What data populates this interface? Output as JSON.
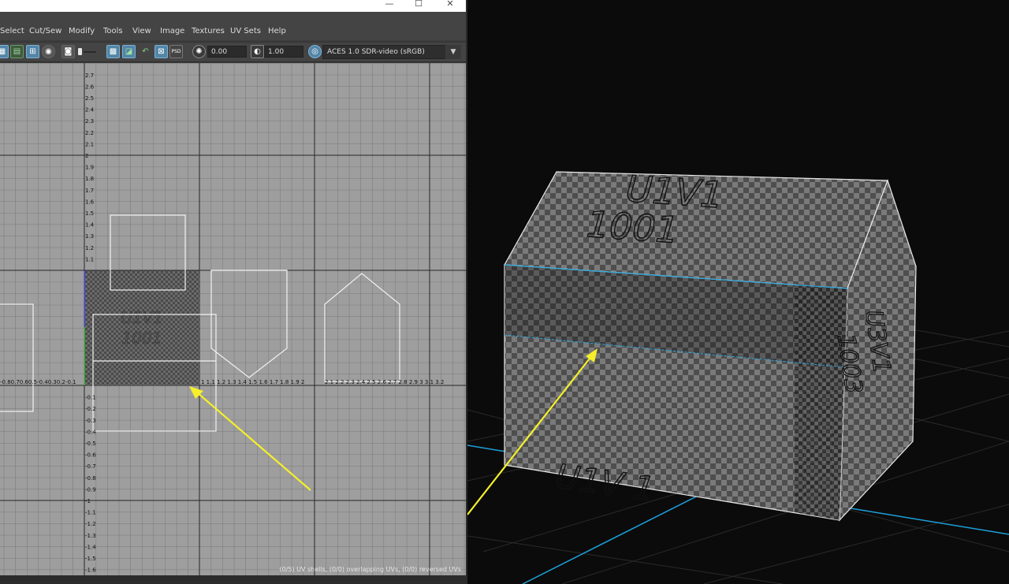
{
  "window": {
    "controls": {
      "minimize": "—",
      "maximize": "☐",
      "close": "✕"
    }
  },
  "menu": {
    "items": [
      "Select",
      "Cut/Sew",
      "Modify",
      "Tools",
      "View",
      "Image",
      "Textures",
      "UV Sets",
      "Help"
    ]
  },
  "toolbar": {
    "exposure_value": "0.00",
    "gamma_value": "1.00",
    "color_space": "ACES 1.0 SDR-video (sRGB)",
    "psd_label": "PSD",
    "icons": [
      "uv-grid-icon",
      "shaded-icon",
      "texture-borders-icon",
      "checker-icon",
      "snapshot-icon",
      "image-dim-icon",
      "display-image-icon",
      "shaded-uv-icon",
      "distortion-icon",
      "isolate-icon",
      "psd-icon",
      "exposure-icon",
      "gamma-icon",
      "color-management-icon"
    ]
  },
  "uv_editor": {
    "v_ticks_pos": [
      "2.7",
      "2.6",
      "2.5",
      "2.4",
      "2.3",
      "2.2",
      "2.1",
      "2",
      "1.9",
      "1.8",
      "1.7",
      "1.6",
      "1.5",
      "1.4",
      "1.3",
      "1.2",
      "1.1"
    ],
    "v_ticks_neg": [
      "-0.1",
      "-0.2",
      "-0.3",
      "-0.4",
      "-0.5",
      "-0.6",
      "-0.7",
      "-0.8",
      "-0.9",
      "-1",
      "-1.1",
      "-1.2",
      "-1.3",
      "-1.4",
      "-1.5",
      "-1.6"
    ],
    "u_ticks_left": "-0.80.70.60.5-0.40.30.2-0.1",
    "u_ticks_right": "1 1.1 1.2 1.3 1.4 1.5 1.6 1.7 1.8 1.9 2",
    "u_ticks_far": "2.1 2.2 2.3 2.4 2.5 2.6 2.7 2.8 2.9 3 3.1 3.2",
    "tile_label_line1": "U1V1",
    "tile_label_line2": "1001",
    "status": "(0/5) UV shells, (0/0) overlapping UVs, (0/0) reversed UVs"
  },
  "viewport": {
    "roof_label_line1": "U1V1",
    "roof_label_line2": "1001",
    "side_label_line1": "U3V1",
    "side_label_line2": "1003",
    "front_label": "U1V 1"
  },
  "colors": {
    "grid_line": "#6e6e6e",
    "grid_major": "#222222",
    "uv_shell": "#f2f2f2",
    "annotation_arrow": "#f5f02a",
    "grid_axis_3d": "#1ea0d8",
    "selected_button": "#5285a6"
  }
}
